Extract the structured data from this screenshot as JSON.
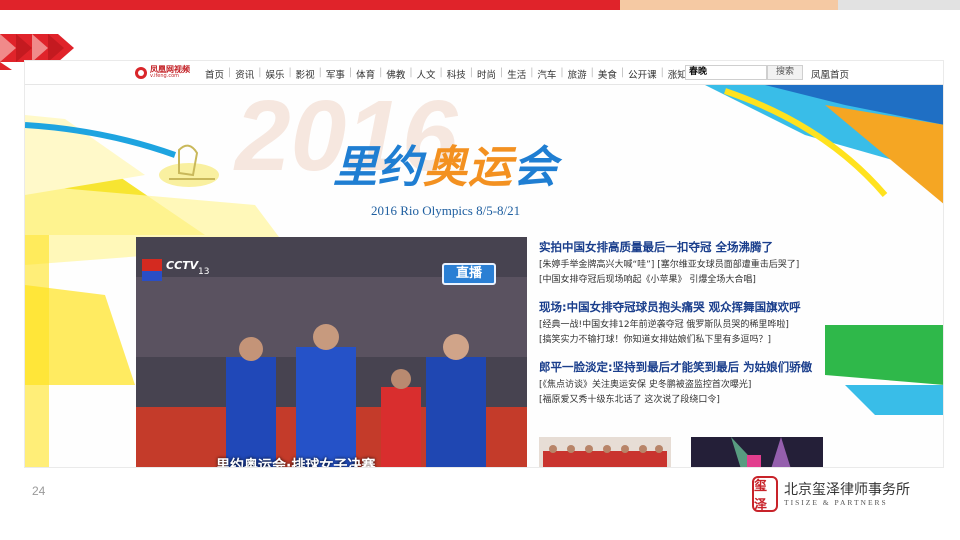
{
  "slide": {
    "page_number": "24",
    "firm_name_cn": "北京玺泽律师事务所",
    "firm_name_en": "TISIZE & PARTNERS",
    "seal_text": "玺泽"
  },
  "site": {
    "logo_cn": "凤凰网视频",
    "logo_en": "v.ifeng.com",
    "nav": [
      "首页",
      "资讯",
      "娱乐",
      "影视",
      "军事",
      "体育",
      "佛教",
      "人文",
      "科技",
      "时尚",
      "生活",
      "汽车",
      "旅游",
      "美食",
      "公开课",
      "涨知识"
    ],
    "search_value": "春晚",
    "search_button": "搜索",
    "home_link": "凤凰首页"
  },
  "banner": {
    "bg_year": "2016",
    "title_blue": "里约",
    "title_orange": "奥运",
    "title_blue2": "会",
    "subtitle": "2016 Rio Olympics 8/5-8/21"
  },
  "video": {
    "live_badge": "直播",
    "channel": "CCTV",
    "channel_number": "13",
    "caption": "里约奥运会·排球女子决赛"
  },
  "news": [
    {
      "headline": "实拍中国女排高质量最后一扣夺冠 全场沸腾了",
      "links": [
        "[朱婷手举金牌高兴大喊“哇”] [塞尔维亚女球员面部遭重击后哭了]",
        "[中国女排夺冠后现场响起《小苹果》 引爆全场大合唱]"
      ]
    },
    {
      "headline": "现场:中国女排夺冠球员抱头痛哭 观众挥舞国旗欢呼",
      "links": [
        "[经典一战!中国女排12年前逆袭夺冠 俄罗斯队员哭的稀里哗啦]",
        "[搞笑实力不输打球！你知道女排姑娘们私下里有多逗吗？]"
      ]
    },
    {
      "headline": "郎平一脸淡定:坚持到最后才能笑到最后 为姑娘们骄傲",
      "links": [
        "[《焦点访谈》关注奥运安保 史冬鹏被盗监控首次曝光]",
        "[福原爱又秀十级东北话了 这次说了段绕口令]"
      ]
    }
  ],
  "colors": {
    "top_bar_red": "#e0232a",
    "top_bar_peach": "#f5c9a3",
    "headline_blue": "#1a3e8c",
    "title_blue": "#1f7ed2",
    "title_orange": "#f39121",
    "seal_red": "#c8232a"
  }
}
